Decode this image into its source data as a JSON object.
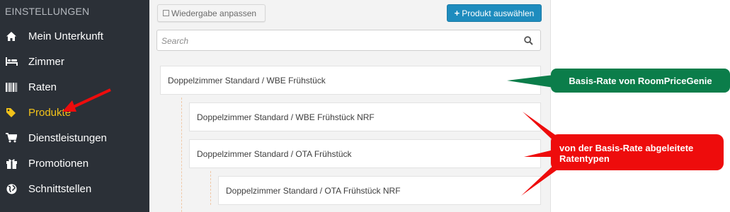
{
  "sidebar": {
    "title": "EINSTELLUNGEN",
    "items": [
      {
        "label": "Mein Unterkunft",
        "icon": "home-icon"
      },
      {
        "label": "Zimmer",
        "icon": "bed-icon"
      },
      {
        "label": "Raten",
        "icon": "barcode-icon"
      },
      {
        "label": "Produkte",
        "icon": "tags-icon",
        "active": true
      },
      {
        "label": "Dienstleistungen",
        "icon": "cart-icon"
      },
      {
        "label": "Promotionen",
        "icon": "gift-icon"
      },
      {
        "label": "Schnittstellen",
        "icon": "globe-icon"
      }
    ]
  },
  "toolbar": {
    "adjust_label": "Wiedergabe anpassen",
    "select_label": "Produkt auswählen"
  },
  "search": {
    "placeholder": "Search"
  },
  "products": [
    {
      "label": "Doppelzimmer Standard / WBE Frühstück",
      "level": 0
    },
    {
      "label": "Doppelzimmer Standard / WBE Frühstück NRF",
      "level": 1
    },
    {
      "label": "Doppelzimmer Standard / OTA Frühstück",
      "level": 1
    },
    {
      "label": "Doppelzimmer Standard / OTA Frühstück NRF",
      "level": 2
    }
  ],
  "annotations": {
    "base_rate": "Basis-Rate von RoomPriceGenie",
    "derived_rates_line1": "von der Basis-Rate abgeleitete",
    "derived_rates_line2": "Ratentypen"
  },
  "colors": {
    "sidebar_bg": "#2b3037",
    "active_item": "#f2c21a",
    "primary_button": "#1e8cbe",
    "callout_green": "#0b7d4a",
    "callout_red": "#ee0c0c"
  }
}
